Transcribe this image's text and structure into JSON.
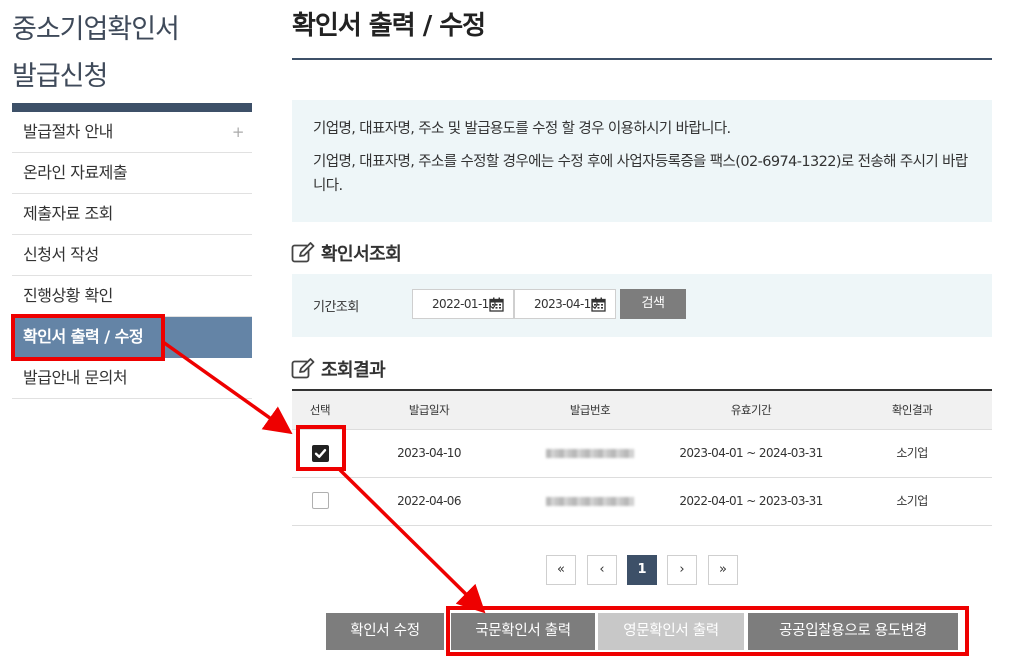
{
  "sidebar": {
    "title_line1": "중소기업확인서",
    "title_line2": "발급신청",
    "items": [
      {
        "label": "발급절차 안내",
        "plus": "+"
      },
      {
        "label": "온라인 자료제출"
      },
      {
        "label": "제출자료 조회"
      },
      {
        "label": "신청서 작성"
      },
      {
        "label": "진행상황 확인"
      },
      {
        "label": "확인서 출력 / 수정",
        "active": true
      },
      {
        "label": "발급안내 문의처"
      }
    ]
  },
  "page": {
    "title": "확인서 출력 / 수정"
  },
  "notice": {
    "line1": "기업명, 대표자명, 주소 및 발급용도를 수정 할 경우 이용하시기 바랍니다.",
    "line2": "기업명, 대표자명, 주소를 수정할 경우에는 수정 후에 사업자등록증을 팩스(02-6974-1322)로 전송해 주시기 바랍니다."
  },
  "search": {
    "section_title": "확인서조회",
    "period_label": "기간조회",
    "start_date": "2022-01-10",
    "end_date": "2023-04-10",
    "search_button": "검색"
  },
  "results": {
    "section_title": "조회결과",
    "columns": [
      "선택",
      "발급일자",
      "발급번호",
      "유효기간",
      "확인결과"
    ],
    "rows": [
      {
        "checked": true,
        "issue_date": "2023-04-10",
        "valid_period": "2023-04-01 ~ 2024-03-31",
        "result": "소기업"
      },
      {
        "checked": false,
        "issue_date": "2022-04-06",
        "valid_period": "2022-04-01 ~ 2023-03-31",
        "result": "소기업"
      }
    ]
  },
  "pagination": {
    "first": "«",
    "prev": "‹",
    "current": "1",
    "next": "›",
    "last": "»"
  },
  "actions": {
    "edit": "확인서 수정",
    "print_korean": "국문확인서 출력",
    "print_english": "영문확인서 출력",
    "change_purpose": "공공입찰용으로 용도변경"
  },
  "colors": {
    "accent_navy": "#3d5068",
    "active_menu": "#6484a6",
    "annotation_red": "#ee0000",
    "panel_bg": "#eef6f8",
    "button_gray": "#7d7d7d"
  }
}
